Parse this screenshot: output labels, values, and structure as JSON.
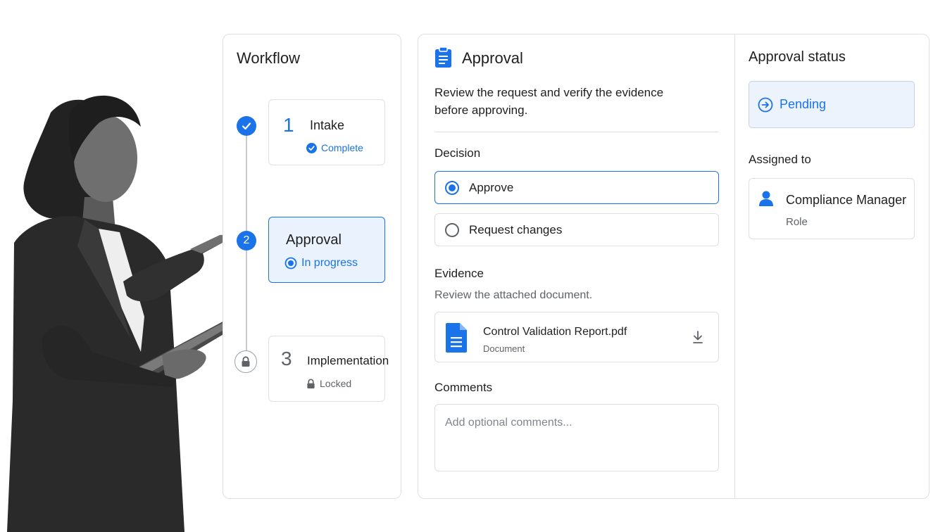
{
  "workflow": {
    "title": "Workflow",
    "steps": [
      {
        "number": "1",
        "name": "Intake",
        "status": "Complete"
      },
      {
        "number": "2",
        "name": "Approval",
        "status": "In progress"
      },
      {
        "number": "3",
        "name": "Implementation",
        "status": "Locked"
      }
    ]
  },
  "approval": {
    "title": "Approval",
    "description_line1": "Review the request and verify the evidence",
    "description_line2": "before approving.",
    "decision": {
      "label": "Decision",
      "options": [
        {
          "label": "Approve",
          "selected": true
        },
        {
          "label": "Request changes",
          "selected": false
        }
      ]
    },
    "evidence": {
      "label": "Evidence",
      "hint": "Review the attached document.",
      "file_name": "Control Validation Report.pdf",
      "file_type": "Document"
    },
    "comments": {
      "label": "Comments",
      "placeholder": "Add optional comments...",
      "value": ""
    }
  },
  "status": {
    "title": "Approval status",
    "value": "Pending",
    "assigned_label": "Assigned to",
    "assignee_name": "Compliance Manager",
    "assignee_role": "Role"
  },
  "colors": {
    "accent": "#1a73e8",
    "active_bg": "#eaf2fe",
    "border": "#dcdfe3",
    "muted_text": "#5f6368"
  }
}
